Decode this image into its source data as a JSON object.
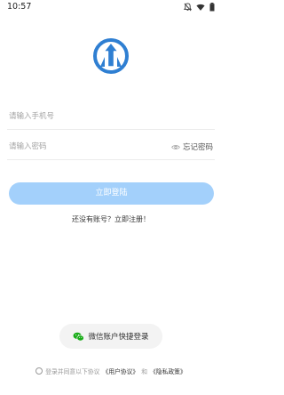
{
  "status_bar": {
    "time": "10:57"
  },
  "form": {
    "phone_placeholder": "请输入手机号",
    "password_placeholder": "请输入密码",
    "forgot_label": "忘记密码"
  },
  "login_button": "立即登陆",
  "register_prompt": "还没有账号？立即注册！",
  "wechat_login": "微信账户快捷登录",
  "agreement": {
    "prefix": "登录并同意以下协议",
    "user_agreement": "《用户协议》",
    "and": "和",
    "privacy_policy": "《隐私政策》"
  },
  "colors": {
    "primary_light": "#a3d0fb",
    "logo_blue": "#2f7fd2",
    "wechat_green": "#1aad19"
  }
}
